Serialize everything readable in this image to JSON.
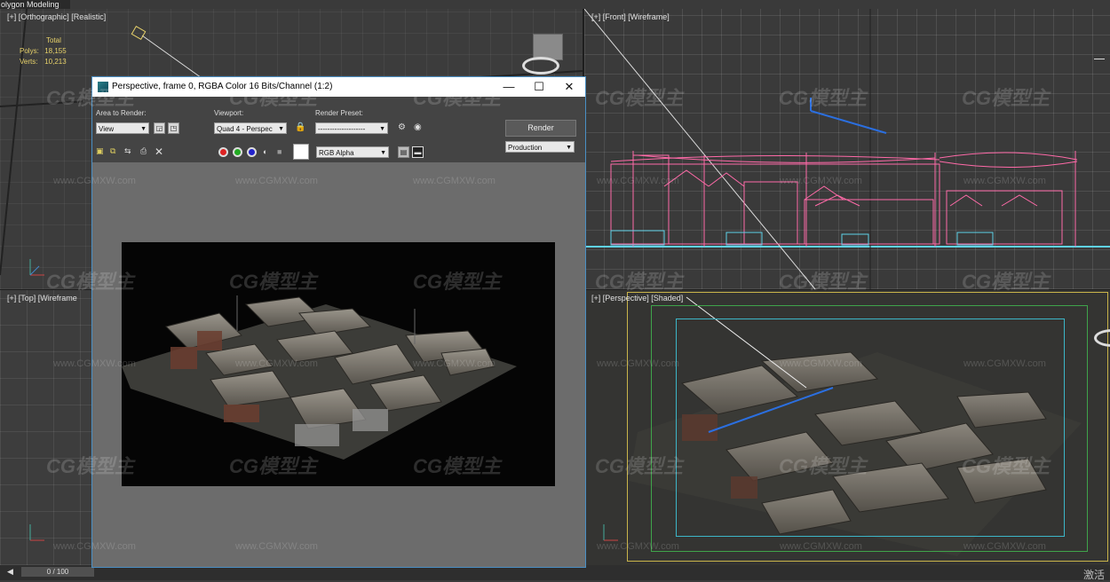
{
  "app": {
    "mode_title": "olygon Modeling"
  },
  "viewports": {
    "ortho_label": "[+] [Orthographic] [Realistic]",
    "front_label": "[+] [Front] [Wireframe]",
    "top_label": "[+] [Top] [Wireframe",
    "persp_label": "[+] [Perspective] [Shaded]"
  },
  "stats": {
    "total_label": "Total",
    "polys_label": "Polys:",
    "polys_value": "18,155",
    "verts_label": "Verts:",
    "verts_value": "10,213"
  },
  "render_window": {
    "title": "Perspective, frame 0, RGBA Color 16 Bits/Channel (1:2)",
    "area_label": "Area to Render:",
    "area_value": "View",
    "viewport_label": "Viewport:",
    "viewport_value": "Quad 4 - Perspec",
    "preset_label": "Render Preset:",
    "preset_value": "--------------------",
    "render_button": "Render",
    "production_value": "Production",
    "channel_value": "RGB Alpha"
  },
  "watermark": {
    "logo_text": "CG模型主",
    "url": "www.CGMXW.com"
  },
  "timeline": {
    "frame": "0 / 100"
  },
  "activate_text": "激活",
  "colors": {
    "wire_pink": "#ff6aa8",
    "wire_cyan": "#5fd3e8",
    "safe_frame_yellow": "#c9b44a",
    "safe_frame_green": "#3fa34a",
    "safe_frame_cyan": "#3cb6c8",
    "stats_yellow": "#e8d26a"
  }
}
